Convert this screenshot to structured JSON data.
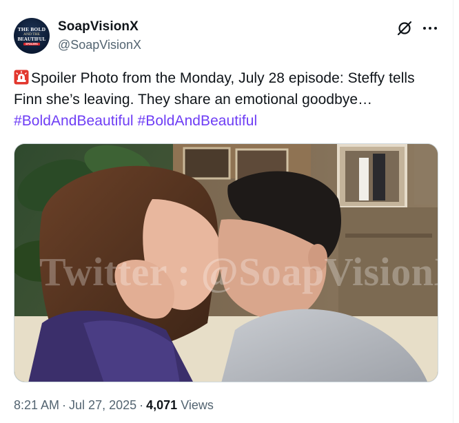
{
  "author": {
    "display_name": "SoapVisionX",
    "handle": "@SoapVisionX",
    "avatar": {
      "line1": "THE BOLD",
      "line2": "AND THE",
      "line3": "BEAUTIFUL",
      "badge": "SPOILERS"
    }
  },
  "header_icons": [
    "grok-icon",
    "more-icon"
  ],
  "tweet": {
    "emoji_icon": "siren-icon",
    "text": "Spoiler Photo from the Monday, July 28 episode: Steffy tells Finn she’s leaving. They share an emotional goodbye…",
    "hashtags": [
      "#BoldAndBeautiful",
      "#BoldAndBeautiful"
    ]
  },
  "media": {
    "watermark": "Twitter : @SoapVisionX"
  },
  "meta": {
    "time": "8:21 AM",
    "date": "Jul 27, 2025",
    "separator": "·",
    "view_count": "4,071",
    "views_label": "Views"
  },
  "colors": {
    "text": "#0f1419",
    "secondary": "#536471",
    "hashtag": "#6e3df5",
    "border": "#cfd9de"
  }
}
